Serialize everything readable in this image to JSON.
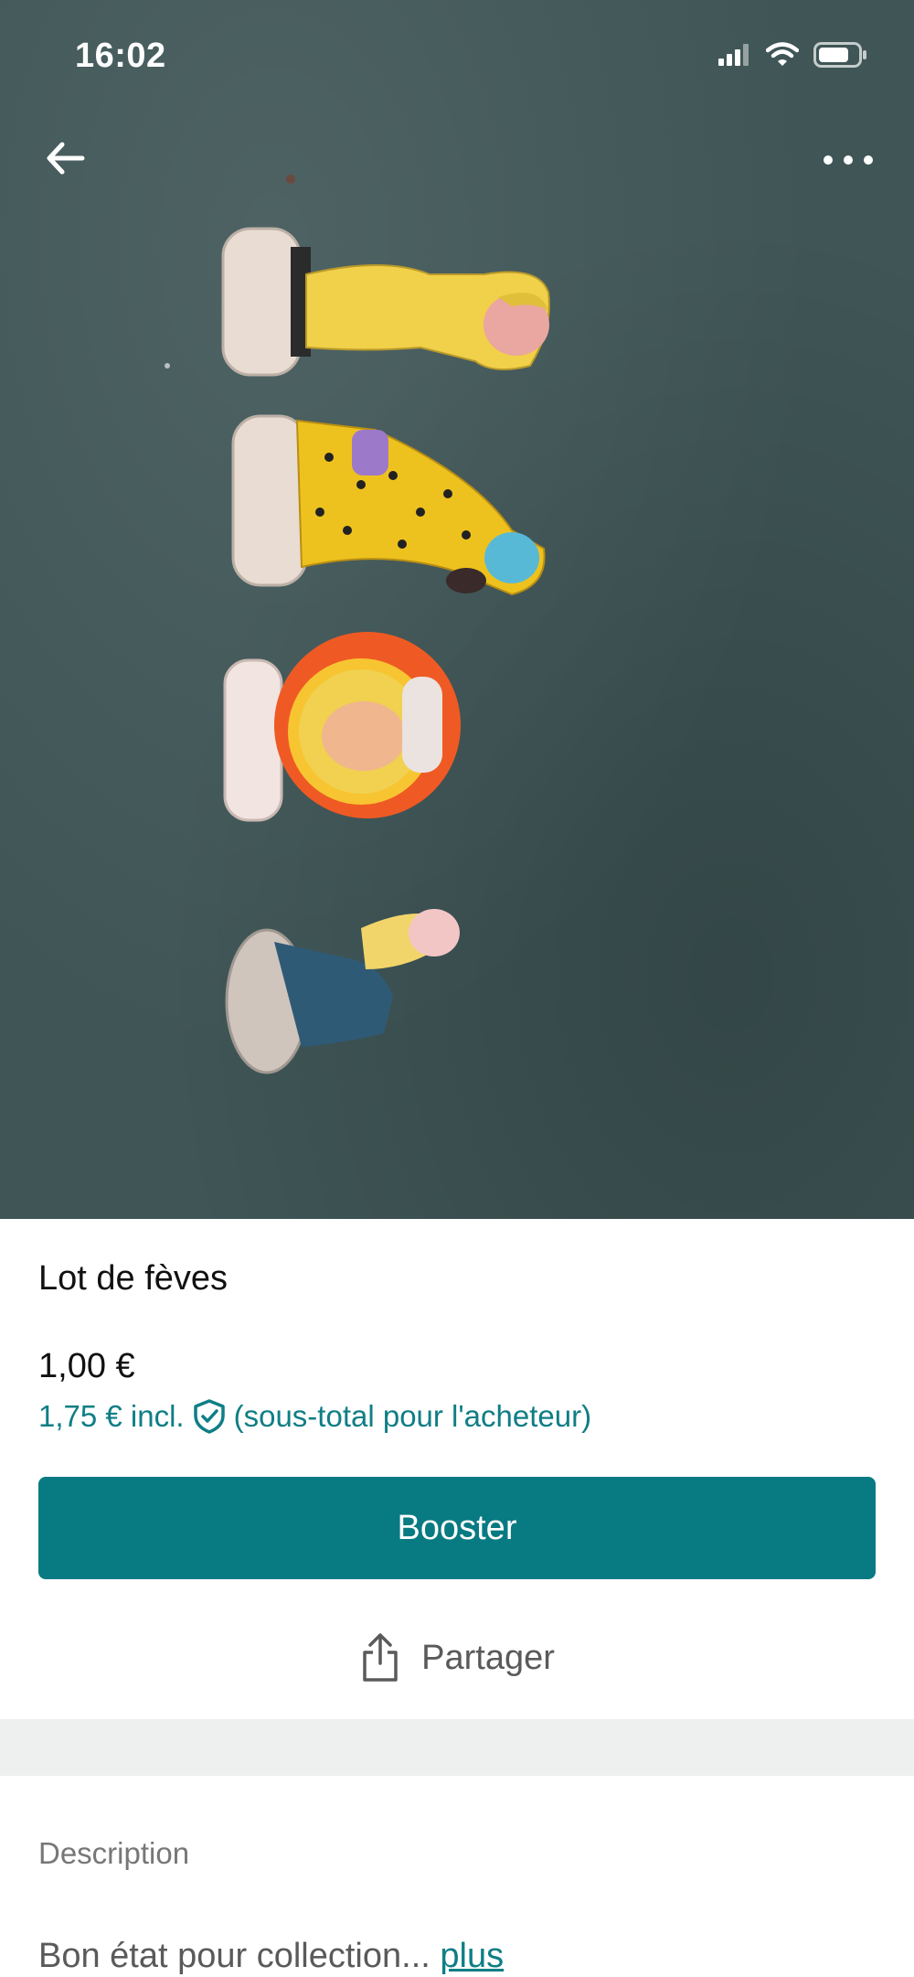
{
  "status_bar": {
    "time": "16:02",
    "icons": [
      "signal-icon",
      "wifi-icon",
      "battery-icon"
    ]
  },
  "nav": {
    "back_icon": "arrow-left-icon",
    "more_icon": "more-horizontal-icon"
  },
  "item": {
    "title": "Lot de fèves",
    "price": "1,00 €",
    "price_incl": "1,75 € incl.",
    "price_note": "(sous-total pour l'acheteur)"
  },
  "actions": {
    "booster_label": "Booster",
    "share_label": "Partager"
  },
  "description": {
    "label": "Description",
    "text": "Bon état pour collection...",
    "more_link": "plus"
  },
  "colors": {
    "accent": "#087a82",
    "accent_text": "#0f7e85",
    "photo_bg": "#3f5556"
  }
}
